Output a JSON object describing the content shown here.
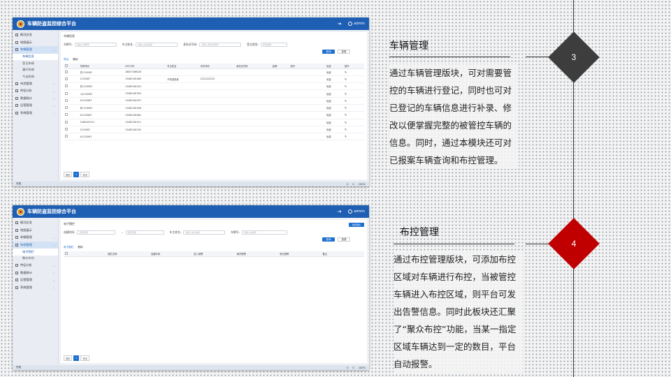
{
  "app": {
    "title": "车辆防盗监控综合平台",
    "user": "admin"
  },
  "sidebar1": [
    {
      "label": "概况总览"
    },
    {
      "label": "地图展示"
    },
    {
      "label": "车辆管理",
      "active": true
    },
    {
      "label": "车辆信息",
      "sub": true,
      "active": true
    },
    {
      "label": "登记车辆",
      "sub": true
    },
    {
      "label": "漏开车辆",
      "sub": true
    },
    {
      "label": "今送车辆",
      "sub": true
    },
    {
      "label": "布控管理"
    },
    {
      "label": "特征分析"
    },
    {
      "label": "数据统计"
    },
    {
      "label": "运营管理"
    },
    {
      "label": "系统管理"
    }
  ],
  "sidebar2": [
    {
      "label": "概况总览"
    },
    {
      "label": "地图展示"
    },
    {
      "label": "车辆管理"
    },
    {
      "label": "布控管理",
      "active": true
    },
    {
      "label": "电子围栏",
      "sub": true,
      "active": true
    },
    {
      "label": "聚众布控",
      "sub": true
    },
    {
      "label": "特征分析"
    },
    {
      "label": "数据统计"
    },
    {
      "label": "运营管理"
    },
    {
      "label": "系统管理"
    }
  ],
  "screen1": {
    "breadcrumb": "车辆信息",
    "filters": [
      {
        "label": "车牌号:",
        "placeholder": "请输入车牌号"
      },
      {
        "label": "车主姓名:",
        "placeholder": "请输入车主姓名"
      },
      {
        "label": "身份证号码:",
        "placeholder": "请输入身份证号码"
      },
      {
        "label": "登记类型:",
        "placeholder": "所有类型"
      }
    ],
    "search": "查询",
    "reset": "重置",
    "tools": [
      "导出",
      "删除"
    ],
    "columns": [
      "",
      "车牌号码",
      "GPS卡号",
      "车主姓名",
      "手机号码",
      "身份证号码",
      "品牌",
      "型号",
      "轨迹",
      "操作"
    ],
    "rows": [
      [
        "苏123456?",
        "18827466526",
        "",
        "",
        "",
        "",
        "",
        "轨迹"
      ],
      [
        "123456?",
        "13465161069",
        "不知道是谁",
        "2222222222",
        "",
        "",
        "",
        "轨迹"
      ],
      [
        "苏1234567",
        "13465161941",
        "",
        "",
        "",
        "",
        "",
        "轨迹"
      ],
      [
        "川1234567",
        "13465161955",
        "",
        "",
        "",
        "",
        "",
        "轨迹"
      ],
      [
        "A1234567",
        "13465161957",
        "",
        "",
        "",
        "",
        "",
        "轨迹"
      ],
      [
        "苏1234567",
        "13465161958",
        "",
        "",
        "",
        "",
        "",
        "轨迹"
      ],
      [
        "A1234567",
        "13465161861",
        "",
        "",
        "",
        "",
        "",
        "轨迹"
      ],
      [
        "1465161511",
        "13465161511",
        "",
        "",
        "",
        "",
        "",
        "轨迹"
      ],
      [
        "123456?",
        "13465161555",
        "",
        "",
        "",
        "",
        "",
        "轨迹"
      ],
      [
        "A1234567",
        "",
        "",
        "",
        "",
        "",
        "",
        "轨迹"
      ]
    ],
    "pager": [
      "首页",
      "1",
      "末页"
    ]
  },
  "screen2": {
    "breadcrumb": "电子围栏",
    "add": "新增围栏",
    "filters": [
      {
        "label": "创建时间:",
        "placeholder": "开始日期"
      },
      {
        "label": "~",
        "placeholder": "结束日期"
      },
      {
        "label": "车主姓名:",
        "placeholder": "请输入车主姓名"
      },
      {
        "label": "车牌号:",
        "placeholder": "请输入车牌号"
      }
    ],
    "search": "查询",
    "reset": "重置",
    "tools": [
      "电子围栏",
      "删除"
    ],
    "columns": [
      "",
      "围栏名称",
      "创建时间",
      "进入报警",
      "离开报警",
      "驶出报警",
      "备注"
    ],
    "pager": [
      "首页",
      "1",
      "末页"
    ]
  },
  "statusbar": {
    "left": "完成",
    "items": [
      "0",
      "0",
      "100%"
    ]
  },
  "section3": {
    "number": "3",
    "title": "车辆管理",
    "body": "通过车辆管理版块，可对需要管控的车辆进行登记，同时也可对已登记的车辆信息进行补录、修改以便掌握完整的被管控车辆的信息。同时，通过本模块还可对已报案车辆查询和布控管理。",
    "color": "#3d3d3d"
  },
  "section4": {
    "number": "4",
    "title": "布控管理",
    "body": "通过布控管理版块，可添加布控区域对车辆进行布控，当被管控车辆进入布控区域，则平台可发出告警信息。同时此板块还汇聚了“聚众布控”功能，当某一指定区域车辆达到一定的数目，平台自动报警。",
    "color": "#c00000"
  }
}
